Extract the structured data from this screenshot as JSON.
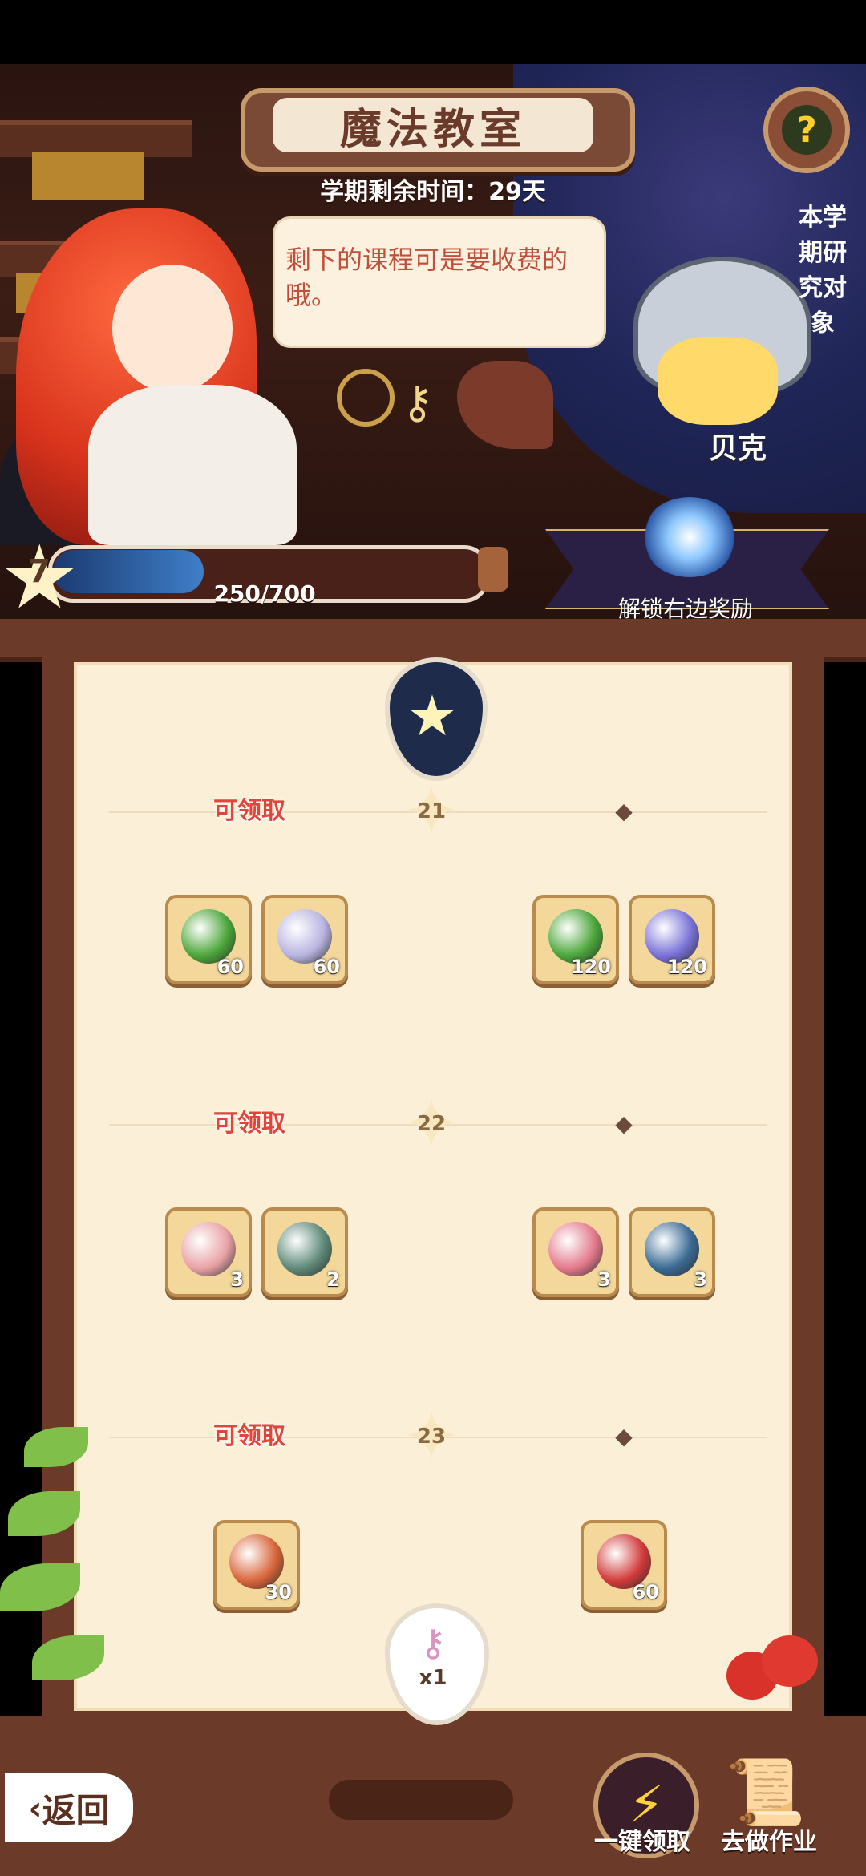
{
  "header": {
    "title": "魔法教室",
    "term_remaining": "学期剩余时间：29天",
    "help_icon": "bulb-question-icon"
  },
  "dialog": {
    "text": "剩下的课程可是要收费的哦。"
  },
  "research_target": {
    "vertical_label": "本学期研究对象",
    "name": "贝克"
  },
  "progress": {
    "level": "7",
    "current": 250,
    "max": 700,
    "text": "250/700",
    "fill_fraction": 0.357
  },
  "unlock_banner": {
    "label": "解锁右边奖励",
    "icon": "glowing-key-icon"
  },
  "claim_label": "可领取",
  "rows": [
    {
      "level": "21",
      "claimable_label": "可领取",
      "free_rewards": [
        {
          "icon": "leaf-orb-icon",
          "color": "#4ca63a",
          "count": "60"
        },
        {
          "icon": "hourglass-orb-icon",
          "color": "#b8b4e0",
          "count": "60"
        }
      ],
      "premium_rewards": [
        {
          "icon": "leaf-orb-icon",
          "color": "#4ca63a",
          "count": "120"
        },
        {
          "icon": "hourglass-orb-icon",
          "color": "#7a72d8",
          "count": "120"
        }
      ]
    },
    {
      "level": "22",
      "claimable_label": "可领取",
      "free_rewards": [
        {
          "icon": "macaron-icon",
          "color": "#e9a2a6",
          "count": "3"
        },
        {
          "icon": "gem-chip-icon",
          "color": "#5f8a7a",
          "count": "2"
        }
      ],
      "premium_rewards": [
        {
          "icon": "macaron-icon",
          "color": "#e47a8c",
          "count": "3"
        },
        {
          "icon": "gem-chip-icon",
          "color": "#3a6a94",
          "count": "3"
        }
      ]
    },
    {
      "level": "23",
      "claimable_label": "可领取",
      "free_rewards": [
        {
          "icon": "berry-cake-icon",
          "color": "#d9653b",
          "count": "30"
        }
      ],
      "premium_rewards": [
        {
          "icon": "berry-cake-icon",
          "color": "#d23a3a",
          "count": "60"
        }
      ]
    }
  ],
  "key_marker": {
    "icon": "pink-key-icon",
    "count": "x1"
  },
  "bottom_bar": {
    "back_label": "返回",
    "collect_all_label": "一键领取",
    "homework_label": "去做作业"
  }
}
